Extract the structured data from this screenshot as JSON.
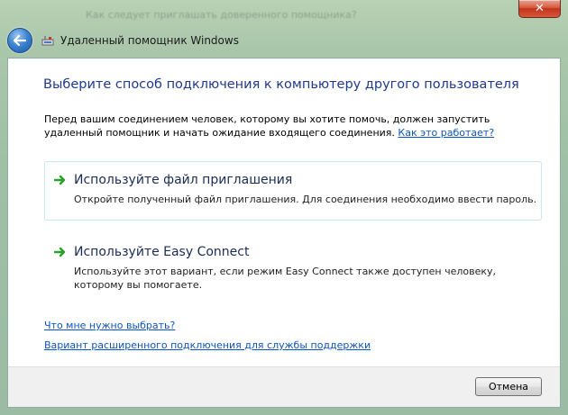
{
  "window": {
    "title": "Удаленный помощник Windows",
    "background_ghost_text": "Как следует приглашать доверенного помощника?",
    "close_label": "✕"
  },
  "main": {
    "heading": "Выберите способ подключения к компьютеру другого пользователя",
    "intro_text": "Перед вашим соединением человек, которому вы хотите помочь, должен запустить удаленный помощник и начать ожидание входящего соединения. ",
    "intro_link": "Как это работает?",
    "options": [
      {
        "title": "Используйте файл приглашения",
        "description": "Откройте полученный файл приглашения.  Для соединения необходимо ввести пароль."
      },
      {
        "title": "Используйте Easy Connect",
        "description": "Используйте этот вариант, если режим Easy Connect также доступен человеку, которому вы помогаете."
      }
    ],
    "links": {
      "which_to_choose": "Что мне нужно выбрать?",
      "advanced_connection": "Вариант расширенного подключения для службы поддержки"
    }
  },
  "footer": {
    "cancel_label": "Отмена"
  },
  "colors": {
    "heading": "#1f3a8c",
    "link": "#0b54c6",
    "arrow": "#2aa02a",
    "selected_border": "#c9e7ef"
  },
  "icons": {
    "back": "back-arrow-icon",
    "app": "remote-assistance-icon",
    "option": "green-arrow-icon"
  }
}
